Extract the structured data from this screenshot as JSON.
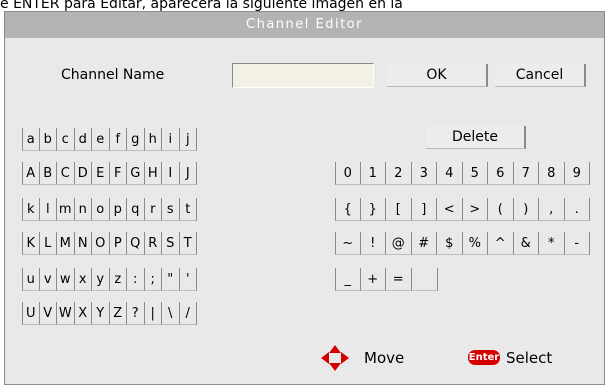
{
  "background_caption": "e ENTER para Editar, aparecerá la siguiente imagen en la",
  "dialog": {
    "title": "Channel Editor",
    "channel_name_label": "Channel Name",
    "channel_name_value": "",
    "ok_label": "OK",
    "cancel_label": "Cancel",
    "delete_label": "Delete"
  },
  "keyboard": {
    "left_rows": [
      [
        "a",
        "b",
        "c",
        "d",
        "e",
        "f",
        "g",
        "h",
        "i",
        "j"
      ],
      [
        "A",
        "B",
        "C",
        "D",
        "E",
        "F",
        "G",
        "H",
        "I",
        "J"
      ],
      [
        "k",
        "l",
        "m",
        "n",
        "o",
        "p",
        "q",
        "r",
        "s",
        "t"
      ],
      [
        "K",
        "L",
        "M",
        "N",
        "O",
        "P",
        "Q",
        "R",
        "S",
        "T"
      ],
      [
        "u",
        "v",
        "w",
        "x",
        "y",
        "z",
        ":",
        ";",
        "\"",
        "'"
      ],
      [
        "U",
        "V",
        "W",
        "X",
        "Y",
        "Z",
        "?",
        "|",
        "\\",
        "/"
      ]
    ],
    "right_rows": [
      [
        "0",
        "1",
        "2",
        "3",
        "4",
        "5",
        "6",
        "7",
        "8",
        "9"
      ],
      [
        "{",
        "}",
        "[",
        "]",
        "<",
        ">",
        "(",
        ")",
        ",",
        "."
      ],
      [
        "~",
        "!",
        "@",
        "#",
        "$",
        "%",
        "^",
        "&",
        "*",
        "-"
      ],
      [
        "_",
        "+",
        "=",
        ""
      ]
    ]
  },
  "legend": {
    "move_label": "Move",
    "enter_badge": "Enter",
    "select_label": "Select"
  },
  "colors": {
    "dialog_bg": "#e9e9e9",
    "titlebar_bg": "#b3b3b3",
    "field_bg": "#f3f0e6",
    "move_icon": "#d40000",
    "enter_badge": "#d40000"
  }
}
